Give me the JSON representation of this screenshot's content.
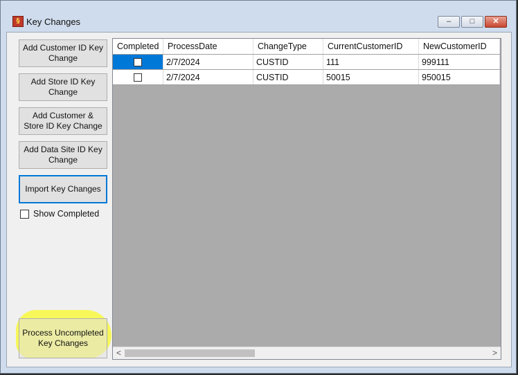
{
  "window": {
    "title": "Key Changes",
    "icon": "app-icon",
    "controls": {
      "minimize": "‒",
      "maximize": "□",
      "close": "✕"
    }
  },
  "buttons": [
    {
      "label": "Add Customer ID Key Change"
    },
    {
      "label": "Add Store ID Key Change"
    },
    {
      "label": "Add Customer & Store ID Key Change"
    },
    {
      "label": "Add Data Site ID Key Change"
    },
    {
      "label": "Import Key Changes"
    }
  ],
  "show_completed": {
    "label": "Show Completed",
    "checked": false
  },
  "process_button": {
    "label": "Process Uncompleted Key Changes"
  },
  "grid": {
    "columns": [
      "Completed",
      "ProcessDate",
      "ChangeType",
      "CurrentCustomerID",
      "NewCustomerID"
    ],
    "rows": [
      {
        "completed": false,
        "process_date": "2/7/2024",
        "change_type": "CUSTID",
        "current_customer_id": "111",
        "new_customer_id": "999111"
      },
      {
        "completed": false,
        "process_date": "2/7/2024",
        "change_type": "CUSTID",
        "current_customer_id": "50015",
        "new_customer_id": "950015"
      }
    ]
  },
  "scrollbar": {
    "left": "<",
    "right": ">"
  },
  "colors": {
    "selection": "#0078d7",
    "highlight": "#fafa28",
    "grid_background": "#ababab"
  }
}
